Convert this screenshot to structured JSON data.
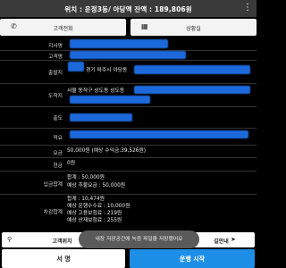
{
  "header": {
    "title": "위치 : 운정3동/ 아당액 잔액 : 189,806원",
    "menu_icon": "vertical-dots-icon"
  },
  "actions": {
    "call_customer": "고객전화",
    "call_shop": "상황실"
  },
  "details": {
    "rows": [
      {
        "label": "지사명",
        "value": ""
      },
      {
        "label": "고객명",
        "value": ""
      },
      {
        "label": "출발지",
        "value": "경기 파주시 아당동"
      },
      {
        "label": "도착지",
        "value": "서울 동작구 상도동 상도동"
      },
      {
        "label": "출도",
        "value": ""
      },
      {
        "label": "적요",
        "value": ""
      },
      {
        "label": "요금",
        "value": "50,000원 (예상 수익금:39,526원)"
      },
      {
        "label": "현금",
        "value": "0원"
      },
      {
        "label": "입금합계",
        "value_lines": [
          "합계 : 50,000원",
          "예상 후불요금 : 50,000원"
        ]
      },
      {
        "label": "차감합계",
        "value_lines": [
          "합계 : 10,474원",
          "예상 운행수수료 : 10,000원",
          "예상 고용보험료 : 219원",
          "예상 산재보험료 : 255원"
        ]
      }
    ]
  },
  "footer": {
    "customer_location": "고객위치",
    "route_guide": "길안내",
    "toast": "내장 저장공간에 녹음 파일을 저장했어요",
    "sign_button": "서 명",
    "start_button": "운행 시작"
  }
}
